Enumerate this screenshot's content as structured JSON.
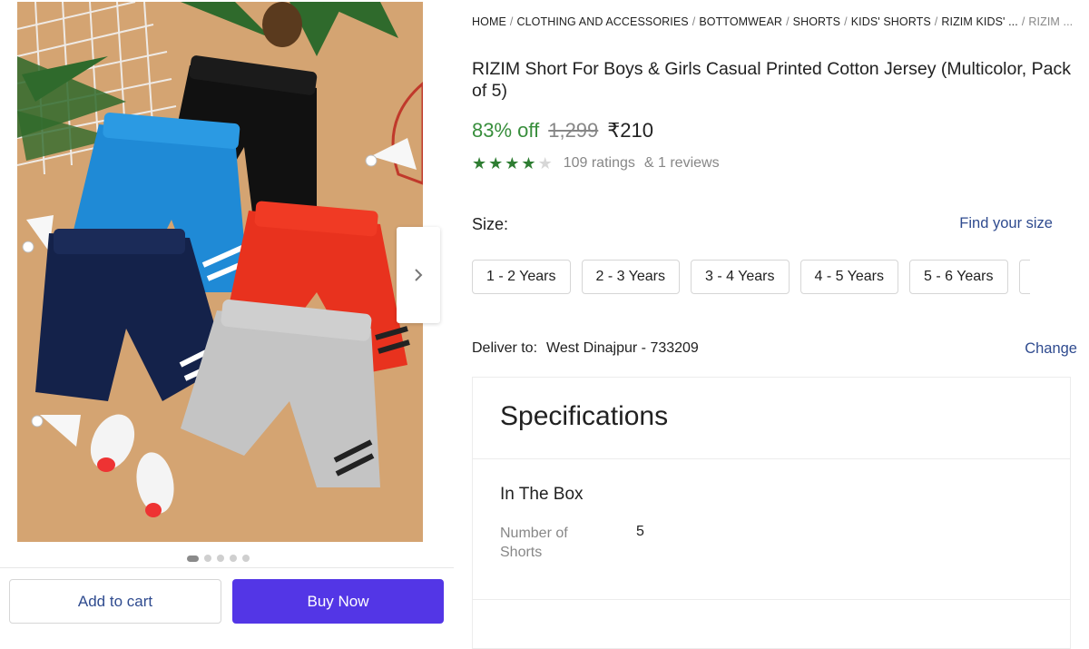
{
  "breadcrumb": {
    "items": [
      "HOME",
      "CLOTHING AND ACCESSORIES",
      "BOTTOMWEAR",
      "SHORTS",
      "KIDS' SHORTS",
      "RIZIM KIDS' ..."
    ],
    "last": "RIZIM ..."
  },
  "product": {
    "title": "RIZIM Short For Boys & Girls Casual Printed Cotton Jersey (Multicolor, Pack of 5)",
    "discount": "83% off",
    "mrp": "1,299",
    "price": "₹210",
    "rating_stars": 4,
    "ratings_text": "109 ratings",
    "reviews_text": "& 1 reviews"
  },
  "gallery": {
    "image_count": 5,
    "active_index": 0,
    "next_icon": "chevron-right-icon"
  },
  "size": {
    "label": "Size:",
    "find_label": "Find your size",
    "options": [
      "1 - 2 Years",
      "2 - 3 Years",
      "3 - 4 Years",
      "4 - 5 Years",
      "5 - 6 Years"
    ]
  },
  "delivery": {
    "label": "Deliver to:",
    "location": "West Dinajpur - 733209",
    "change_label": "Change"
  },
  "specifications": {
    "title": "Specifications",
    "section": "In The Box",
    "rows": [
      {
        "key": "Number of Shorts",
        "value": "5"
      }
    ]
  },
  "actions": {
    "add_to_cart": "Add to cart",
    "buy_now": "Buy Now"
  },
  "colors": {
    "accent": "#5336e6",
    "link": "#2f4b8f",
    "discount": "#388e3c",
    "star": "#2e7d32"
  }
}
